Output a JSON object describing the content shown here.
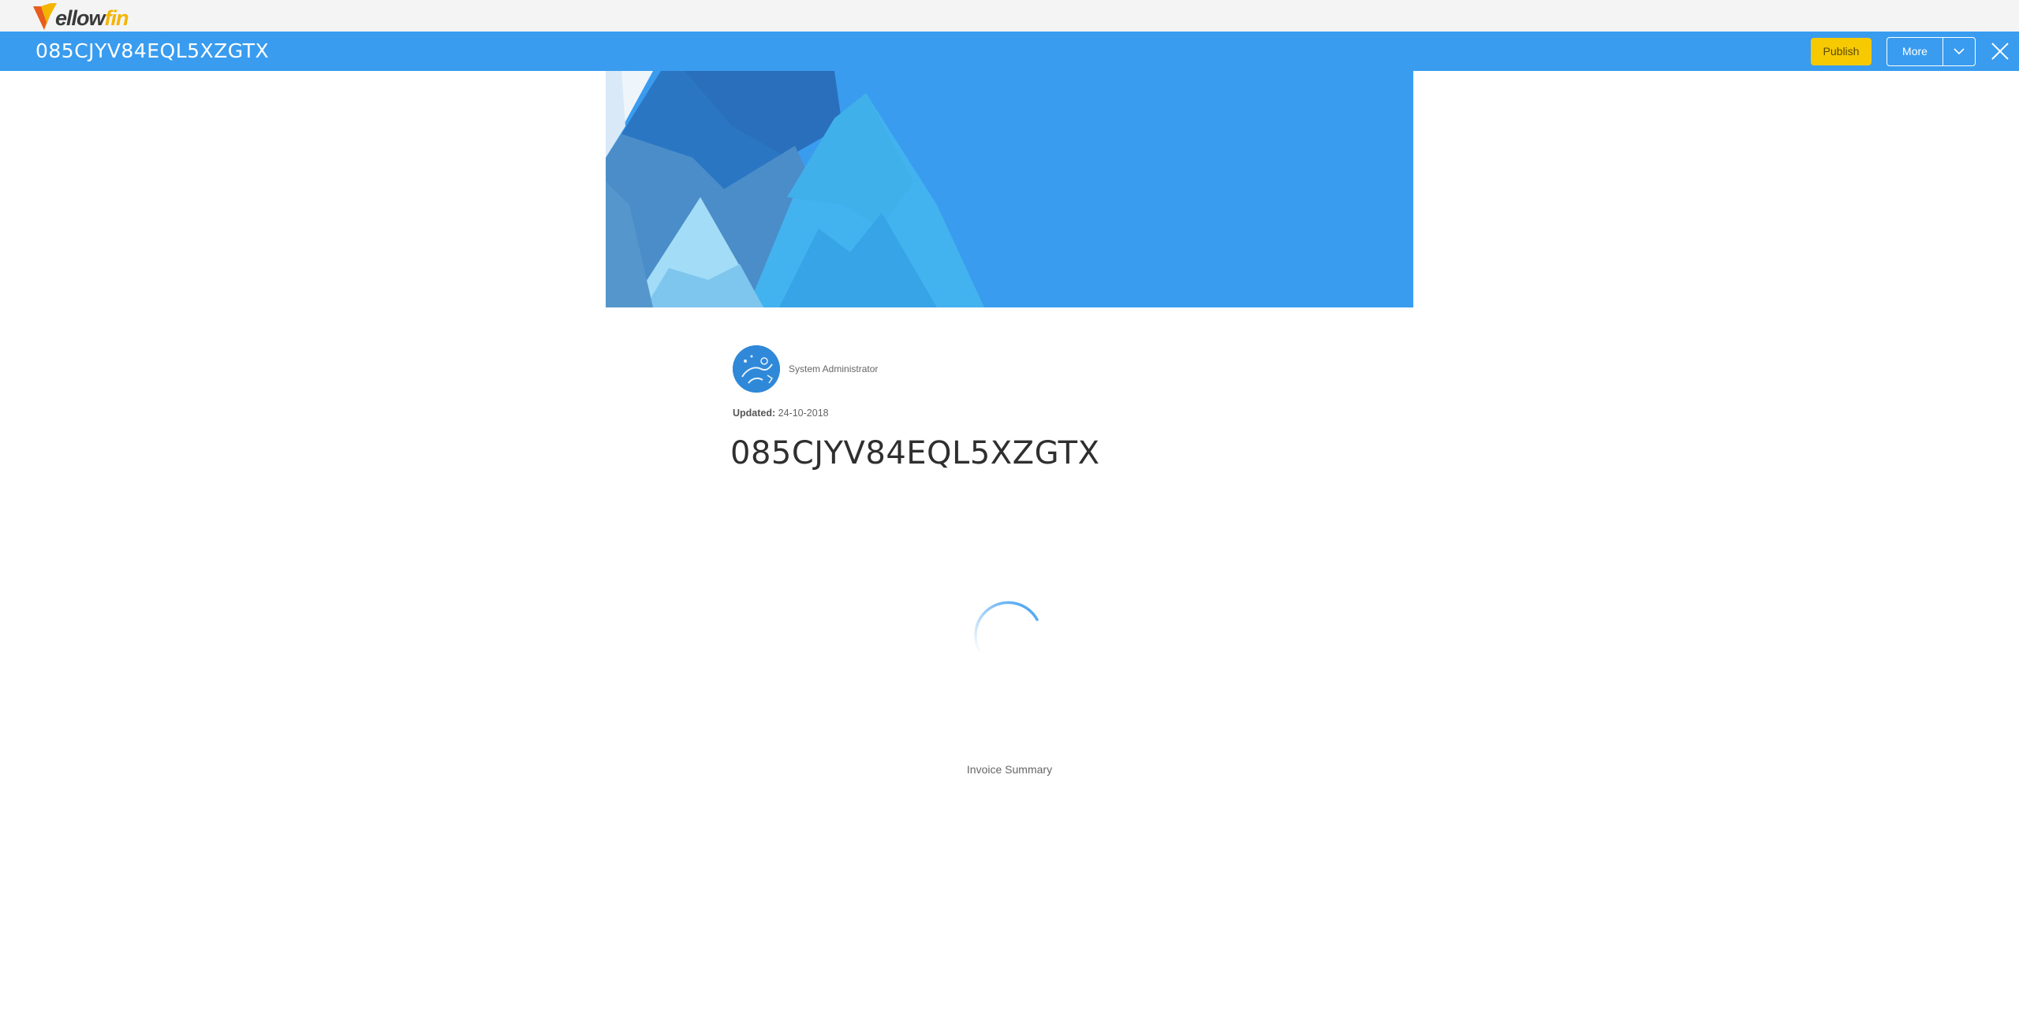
{
  "app": {
    "logo_text_primary": "ellow",
    "logo_text_secondary": "fin",
    "logo_icon": "yellowfin-v-logo",
    "brand_color": "#f5b400",
    "header_color": "#3a9cee"
  },
  "header": {
    "title": "085CJYV84EQL5XZGTX",
    "publish_label": "Publish",
    "more_label": "More",
    "more_caret_icon": "chevron-down-icon",
    "close_icon": "close-icon"
  },
  "story": {
    "author_name": "System Administrator",
    "updated_label": "Updated:",
    "updated_value": "24-10-2018",
    "title": "085CJYV84EQL5XZGTX",
    "content_status": "loading",
    "content_caption": "Invoice Summary"
  }
}
